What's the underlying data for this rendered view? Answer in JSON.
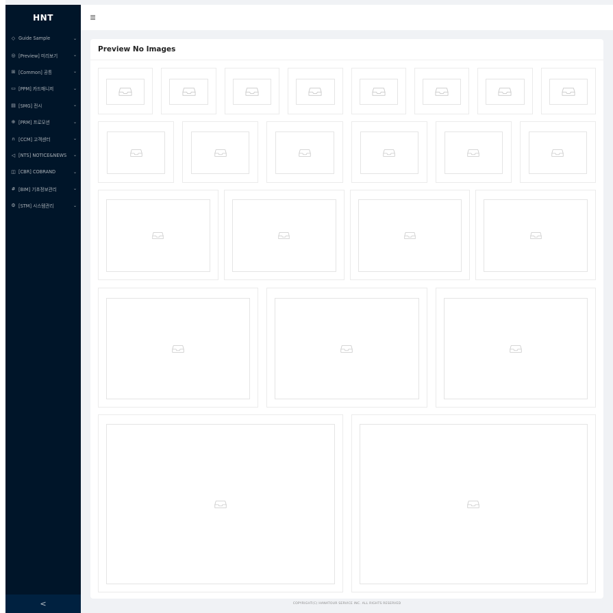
{
  "app": {
    "logo": "HNT"
  },
  "sidebar": {
    "items": [
      {
        "icon": "location-pin-icon",
        "glyph": "◇",
        "label": "Guide Sample"
      },
      {
        "icon": "eye-icon",
        "glyph": "◎",
        "label": "[Preview] 미리보기"
      },
      {
        "icon": "grid-icon",
        "glyph": "⊞",
        "label": "[Common] 공통"
      },
      {
        "icon": "card-icon",
        "glyph": "▭",
        "label": "[PPM] 카드매니저"
      },
      {
        "icon": "calendar-icon",
        "glyph": "▤",
        "label": "[SMG] 전시"
      },
      {
        "icon": "gift-icon",
        "glyph": "⊕",
        "label": "[PRM] 프로모션"
      },
      {
        "icon": "headset-icon",
        "glyph": "∩",
        "label": "[CCM] 고객센터"
      },
      {
        "icon": "megaphone-icon",
        "glyph": "◁",
        "label": "[NTS] NOTICE&NEWS"
      },
      {
        "icon": "frame-icon",
        "glyph": "◫",
        "label": "[CBR] COBRAND"
      },
      {
        "icon": "hash-icon",
        "glyph": "#",
        "label": "[BIM] 기초정보관리"
      },
      {
        "icon": "settings-icon",
        "glyph": "⚙",
        "label": "[STM] 시스템관리"
      }
    ],
    "collapse_glyph": "<"
  },
  "header": {
    "toggle_glyph": "≣"
  },
  "card": {
    "title": "Preview No Images"
  },
  "footer": {
    "copyright": "COPYRIGHT(C) HANATOUR SERVICE INC. ALL RIGHTS RESERVED"
  },
  "grid": {
    "rows": [
      8,
      6,
      4,
      3,
      2
    ]
  },
  "colors": {
    "sidebar_bg": "#001529",
    "page_bg": "#f0f2f5",
    "placeholder_icon": "#c9c9c9"
  }
}
